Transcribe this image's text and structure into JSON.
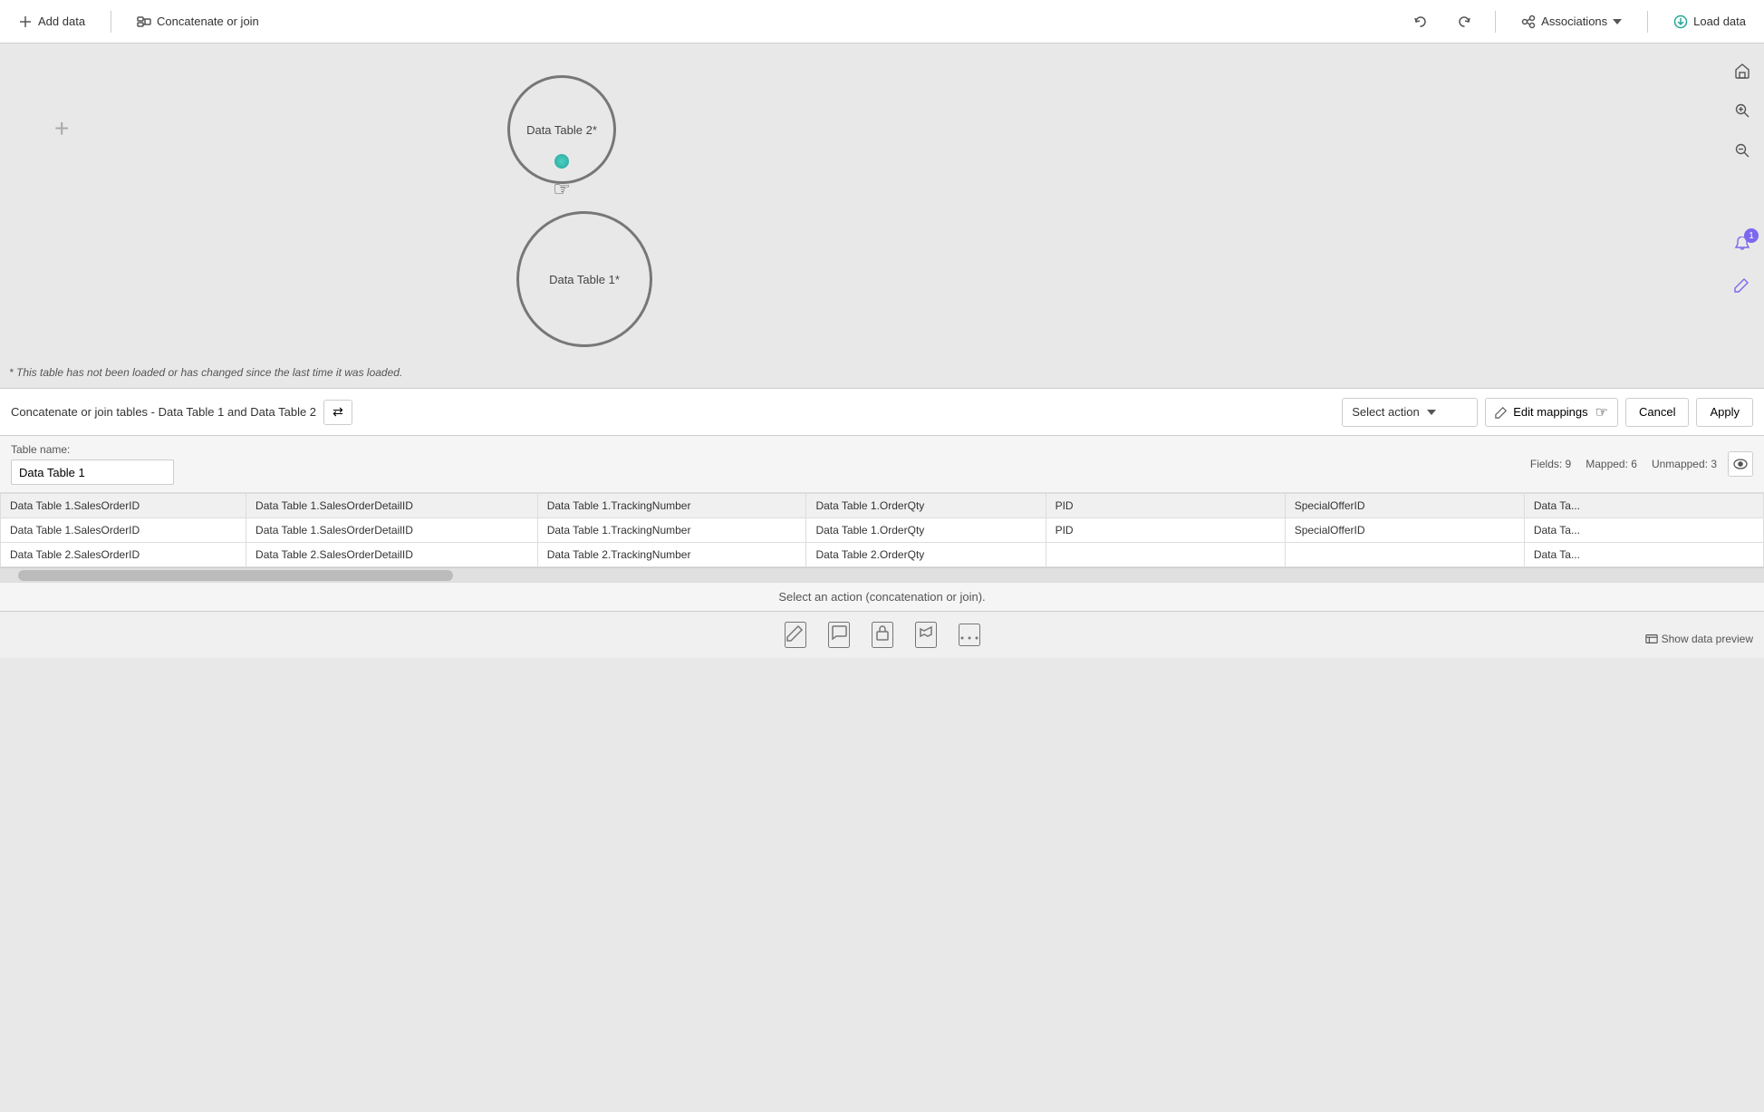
{
  "toolbar": {
    "add_data": "Add data",
    "concatenate_join": "Concatenate or join",
    "undo_title": "Undo",
    "redo_title": "Redo",
    "associations": "Associations",
    "load_data": "Load data"
  },
  "canvas": {
    "node2_label": "Data Table 2*",
    "node1_label": "Data Table 1*",
    "note": "* This table has not been loaded or has changed since the last time it was loaded."
  },
  "concat_panel": {
    "title": "Concatenate or join tables - Data Table 1 and Data Table 2",
    "select_action": "Select action",
    "edit_mappings": "Edit mappings",
    "cancel": "Cancel",
    "apply": "Apply",
    "table_name_label": "Table name:",
    "table_name_value": "Data Table 1",
    "fields_label": "Fields: 9",
    "mapped_label": "Mapped: 6",
    "unmapped_label": "Unmapped: 3"
  },
  "grid": {
    "columns": [
      "Data Table 1.SalesOrderID",
      "Data Table 1.SalesOrderDetailID",
      "Data Table 1.TrackingNumber",
      "Data Table 1.OrderQty",
      "PID",
      "SpecialOfferID",
      "Data Ta..."
    ],
    "rows": [
      [
        "Data Table 1.SalesOrderID",
        "Data Table 1.SalesOrderDetailID",
        "Data Table 1.TrackingNumber",
        "Data Table 1.OrderQty",
        "PID",
        "SpecialOfferID",
        "Data Ta..."
      ],
      [
        "Data Table 2.SalesOrderID",
        "Data Table 2.SalesOrderDetailID",
        "Data Table 2.TrackingNumber",
        "Data Table 2.OrderQty",
        "",
        "",
        "Data Ta..."
      ]
    ]
  },
  "hint": "Select an action (concatenation or join).",
  "bottom_icons": [
    "pencil-icon",
    "chat-icon",
    "lock-icon",
    "settings-icon",
    "more-icon"
  ],
  "show_data_preview": "Show data preview",
  "badge_count": "1"
}
